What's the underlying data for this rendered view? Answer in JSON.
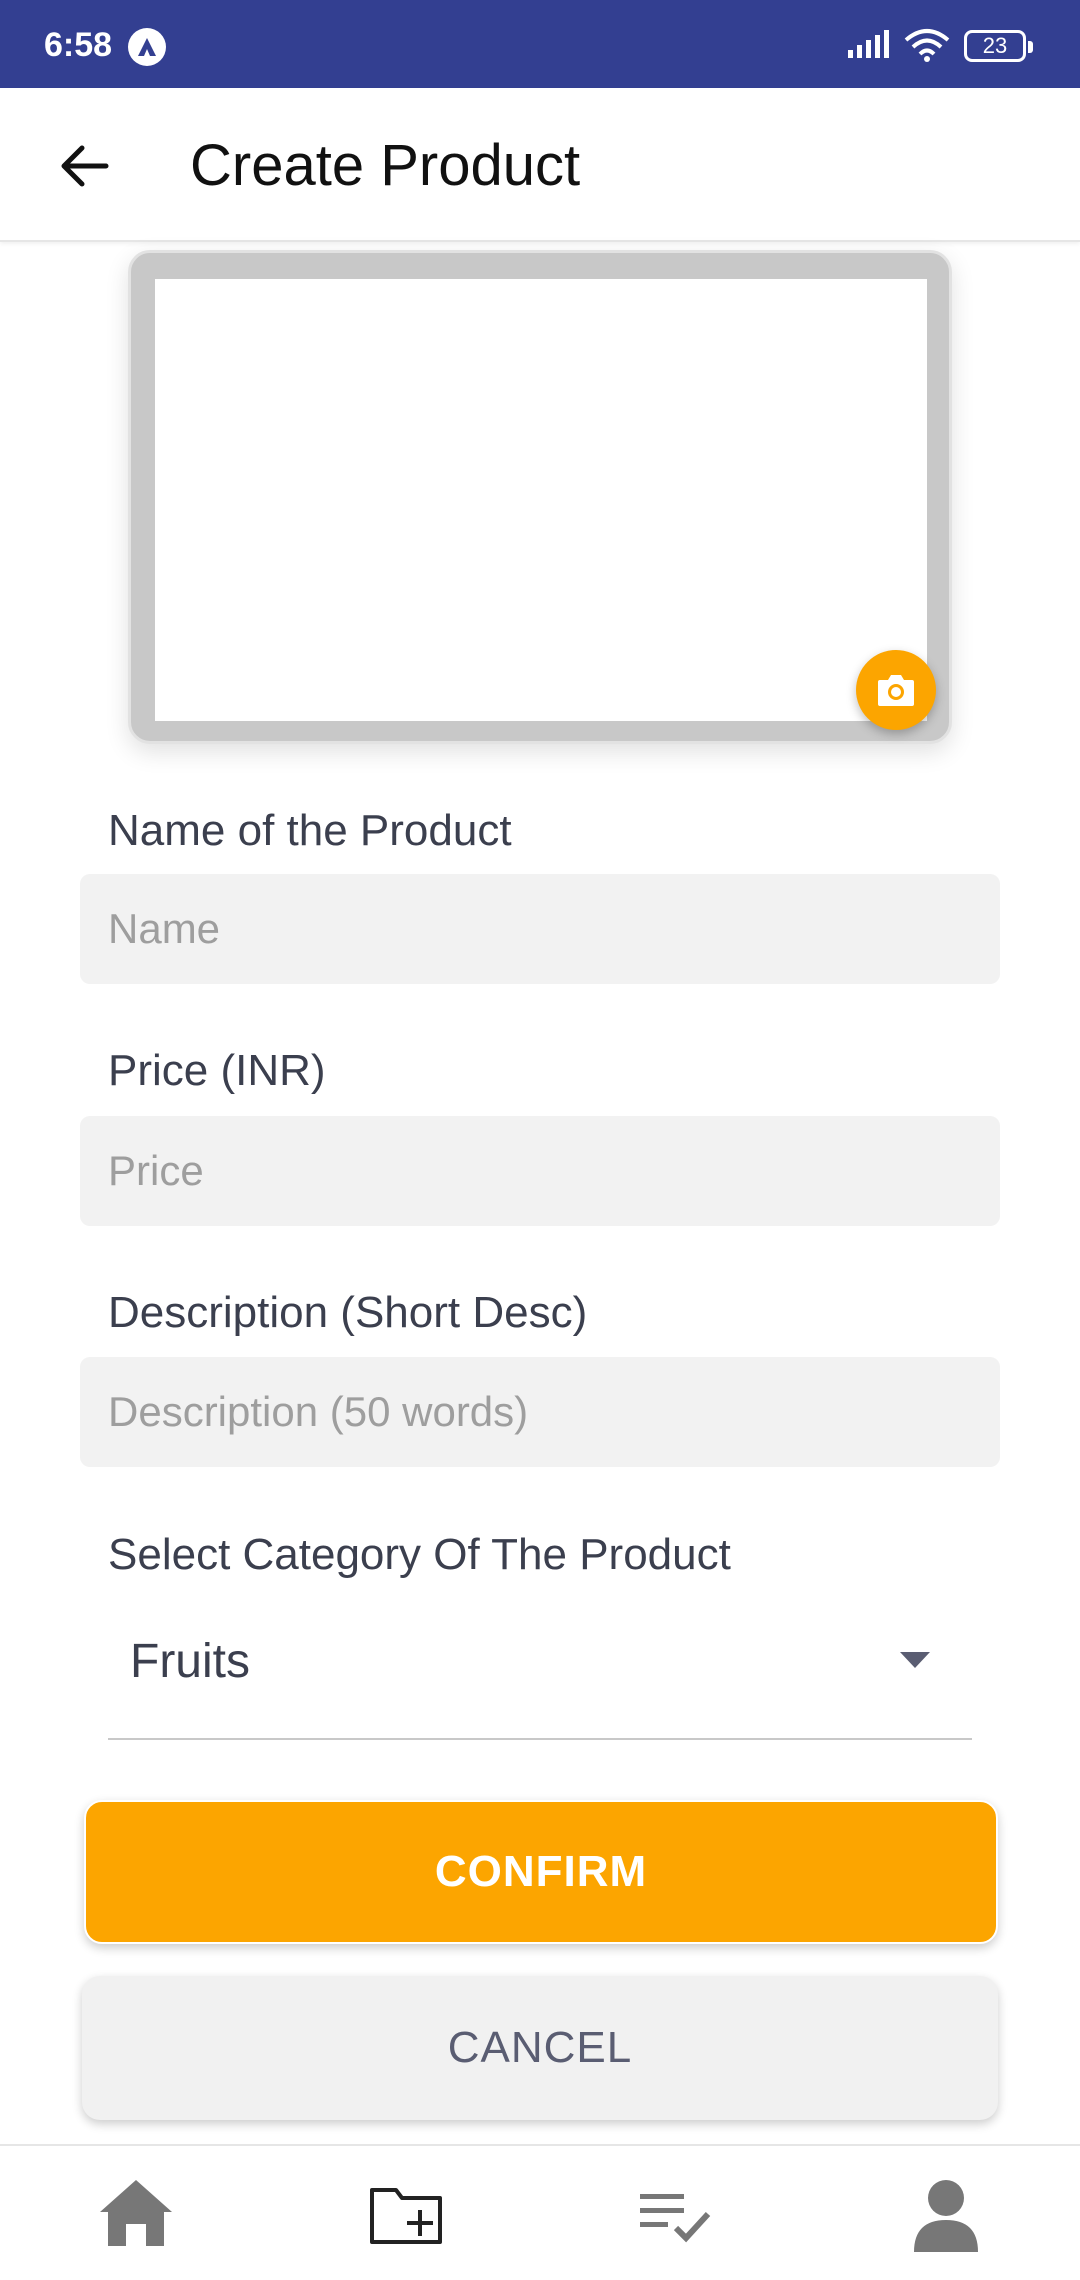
{
  "status_bar": {
    "time": "6:58",
    "battery": "23"
  },
  "app_bar": {
    "title": "Create Product"
  },
  "form": {
    "name": {
      "label": "Name of the Product",
      "placeholder": "Name",
      "value": ""
    },
    "price": {
      "label": "Price (INR)",
      "placeholder": "Price",
      "value": ""
    },
    "description": {
      "label": "Description (Short Desc)",
      "placeholder": "Description (50 words)",
      "value": ""
    },
    "category": {
      "label": "Select Category Of The Product",
      "selected": "Fruits"
    }
  },
  "actions": {
    "confirm_label": "CONFIRM",
    "cancel_label": "CANCEL"
  },
  "bottom_nav": {
    "items": [
      "home-icon",
      "add-folder-icon",
      "list-check-icon",
      "profile-icon"
    ]
  },
  "colors": {
    "status_bar": "#333f91",
    "accent": "#fca500",
    "input_bg": "#f2f2f2"
  }
}
